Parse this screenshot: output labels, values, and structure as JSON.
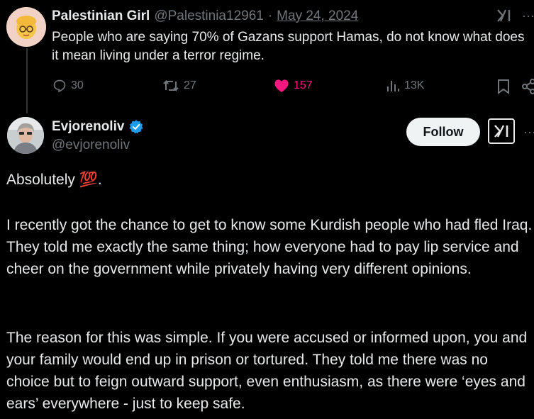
{
  "quoted": {
    "name": "Palestinian Girl",
    "handle": "@Palestinia12961",
    "separator": "·",
    "date": "May 24, 2024",
    "text": "People who are saying 70% of Gazans support Hamas, do not know what does it mean living under a terror regime.",
    "more": "···",
    "actions": {
      "replies": "30",
      "reposts": "27",
      "likes": "157",
      "views": "13K"
    },
    "colors": {
      "like": "#f91880",
      "muted": "#71767b"
    }
  },
  "post": {
    "name": "Evjorenoliv",
    "handle": "@evjorenoliv",
    "verified_color": "#1d9bf0",
    "follow_label": "Follow",
    "more": "···",
    "paragraphs": [
      "Absolutely 💯.",
      "I  recently got the chance to get to know some Kurdish people who had fled Iraq. They told me exactly the same thing; how everyone had to pay lip service and cheer on the government while privately having very different opinions.",
      "The reason for this was simple. If you were accused or informed upon, you and your family would end up in prison or tortured. They told me there was no choice but to feign outward support, even enthusiasm, as there were ‘eyes and ears’ everywhere - just to keep safe."
    ]
  }
}
